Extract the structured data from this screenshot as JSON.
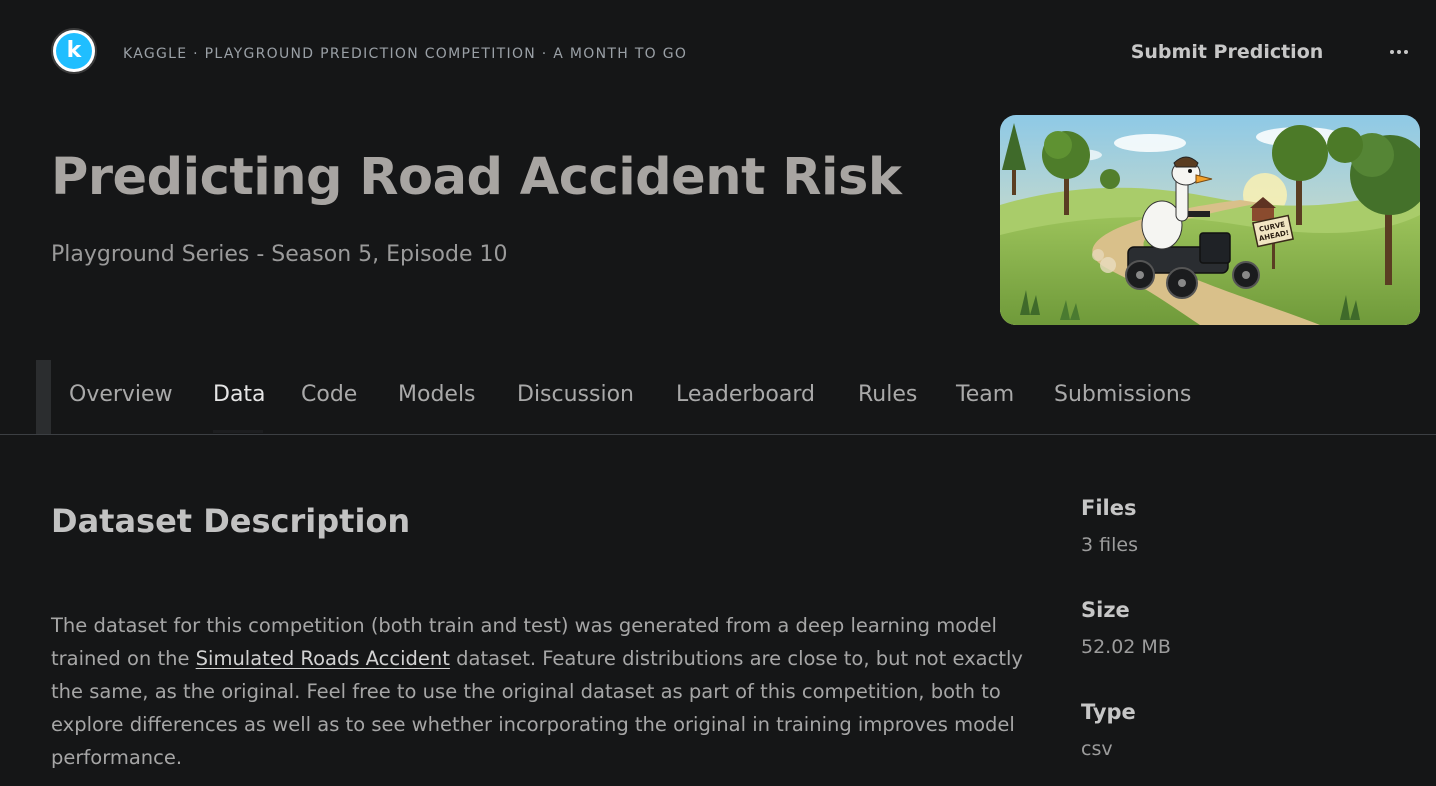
{
  "header": {
    "logo_letter": "k",
    "breadcrumb": "KAGGLE · PLAYGROUND PREDICTION COMPETITION · A MONTH TO GO",
    "submit_label": "Submit Prediction",
    "more_icon": "more-horizontal-icon"
  },
  "competition": {
    "title": "Predicting Road Accident Risk",
    "subtitle": "Playground Series - Season 5, Episode 10",
    "hero_image": {
      "sign_line1": "CURVE",
      "sign_line2": "AHEAD!"
    }
  },
  "tabs": [
    {
      "label": "Overview",
      "active": false
    },
    {
      "label": "Data",
      "active": true
    },
    {
      "label": "Code",
      "active": false
    },
    {
      "label": "Models",
      "active": false
    },
    {
      "label": "Discussion",
      "active": false
    },
    {
      "label": "Leaderboard",
      "active": false
    },
    {
      "label": "Rules",
      "active": false
    },
    {
      "label": "Team",
      "active": false
    },
    {
      "label": "Submissions",
      "active": false
    }
  ],
  "dataset": {
    "heading": "Dataset Description",
    "description_before": "The dataset for this competition (both train and test) was generated from a deep learning model trained on the ",
    "description_link": "Simulated Roads Accident",
    "description_after": " dataset. Feature distributions are close to, but not exactly the same, as the original. Feel free to use the original dataset as part of this competition, both to explore differences as well as to see whether incorporating the original in training improves model performance."
  },
  "meta": {
    "files_label": "Files",
    "files_value": "3 files",
    "size_label": "Size",
    "size_value": "52.02 MB",
    "type_label": "Type",
    "type_value": "csv"
  },
  "colors": {
    "background": "#151617",
    "kaggle_blue": "#20beff"
  }
}
